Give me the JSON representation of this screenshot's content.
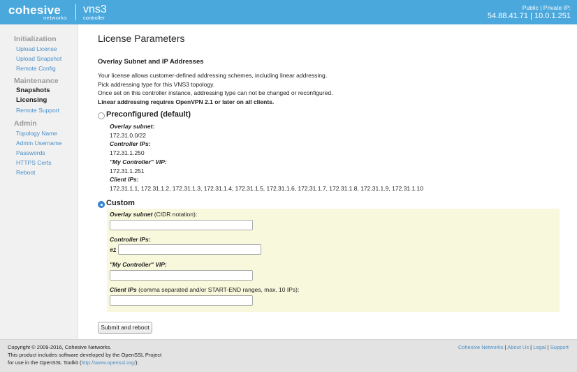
{
  "header": {
    "logo_main": "cohesive",
    "logo_sub": "networks",
    "product_main": "vns3",
    "product_sub": "controller",
    "ip_label": "Public | Private IP:",
    "ip_value": "54.88.41.71 | 10.0.1.251",
    "colors": {
      "header_bg": "#4aa8dd",
      "link": "#4a8fc7"
    }
  },
  "sidebar": {
    "initialization": {
      "heading": "Initialization",
      "items": [
        "Upload License",
        "Upload Snapshot",
        "Remote Config"
      ]
    },
    "maintenance": {
      "heading": "Maintenance",
      "items": [
        "Snapshots",
        "Licensing",
        "Remote Support"
      ]
    },
    "admin": {
      "heading": "Admin",
      "items": [
        "Topology Name",
        "Admin Username",
        "Passwords",
        "HTTPS Certs",
        "Reboot"
      ]
    }
  },
  "main": {
    "title": "License Parameters",
    "section_title": "Overlay Subnet and IP Addresses",
    "desc": [
      "Your license allows customer-defined addressing schemes, including linear addressing.",
      "Pick addressing type for this VNS3 topology.",
      "Once set on this controller instance, addressing type can not be changed or reconfigured.",
      "Linear addressing requires OpenVPN 2.1 or later on all clients."
    ],
    "preconfigured": {
      "label": "Preconfigured (default)",
      "selected": false,
      "overlay_subnet_label": "Overlay subnet",
      "overlay_subnet_value": "172.31.0.0/22",
      "controller_ips_label": "Controller IPs",
      "controller_ips_value": "172.31.1.250",
      "vip_label": "\"My Controller\" VIP",
      "vip_value": "172.31.1.251",
      "client_ips_label": "Client IPs",
      "client_ips_value": "172.31.1.1, 172.31.1.2, 172.31.1.3, 172.31.1.4, 172.31.1.5, 172.31.1.6, 172.31.1.7, 172.31.1.8, 172.31.1.9, 172.31.1.10"
    },
    "custom": {
      "label": "Custom",
      "selected": true,
      "overlay_subnet_label": "Overlay subnet",
      "overlay_subnet_hint": "(CIDR notation):",
      "overlay_subnet_value": "",
      "controller_ips_label": "Controller IPs",
      "controller_ip_index": "#1",
      "controller_ip_value": "",
      "vip_label": "\"My Controller\" VIP",
      "vip_value": "",
      "client_ips_label": "Client IPs",
      "client_ips_hint": "(comma separated and/or START-END ranges, max. 10 IPs):",
      "client_ips_value": ""
    },
    "submit_label": "Submit and reboot"
  },
  "footer": {
    "copyright": "Copyright © 2009-2016, Cohesive Networks.",
    "openssl_line1": "This product includes software developed by the OpenSSL Project",
    "openssl_line2_pre": "for use in the OpenSSL Toolkit (",
    "openssl_link": "http://www.openssl.org/",
    "openssl_line2_post": ").",
    "links": [
      "Cohesive Networks",
      "About Us",
      "Legal",
      "Support"
    ],
    "separator": "|"
  }
}
